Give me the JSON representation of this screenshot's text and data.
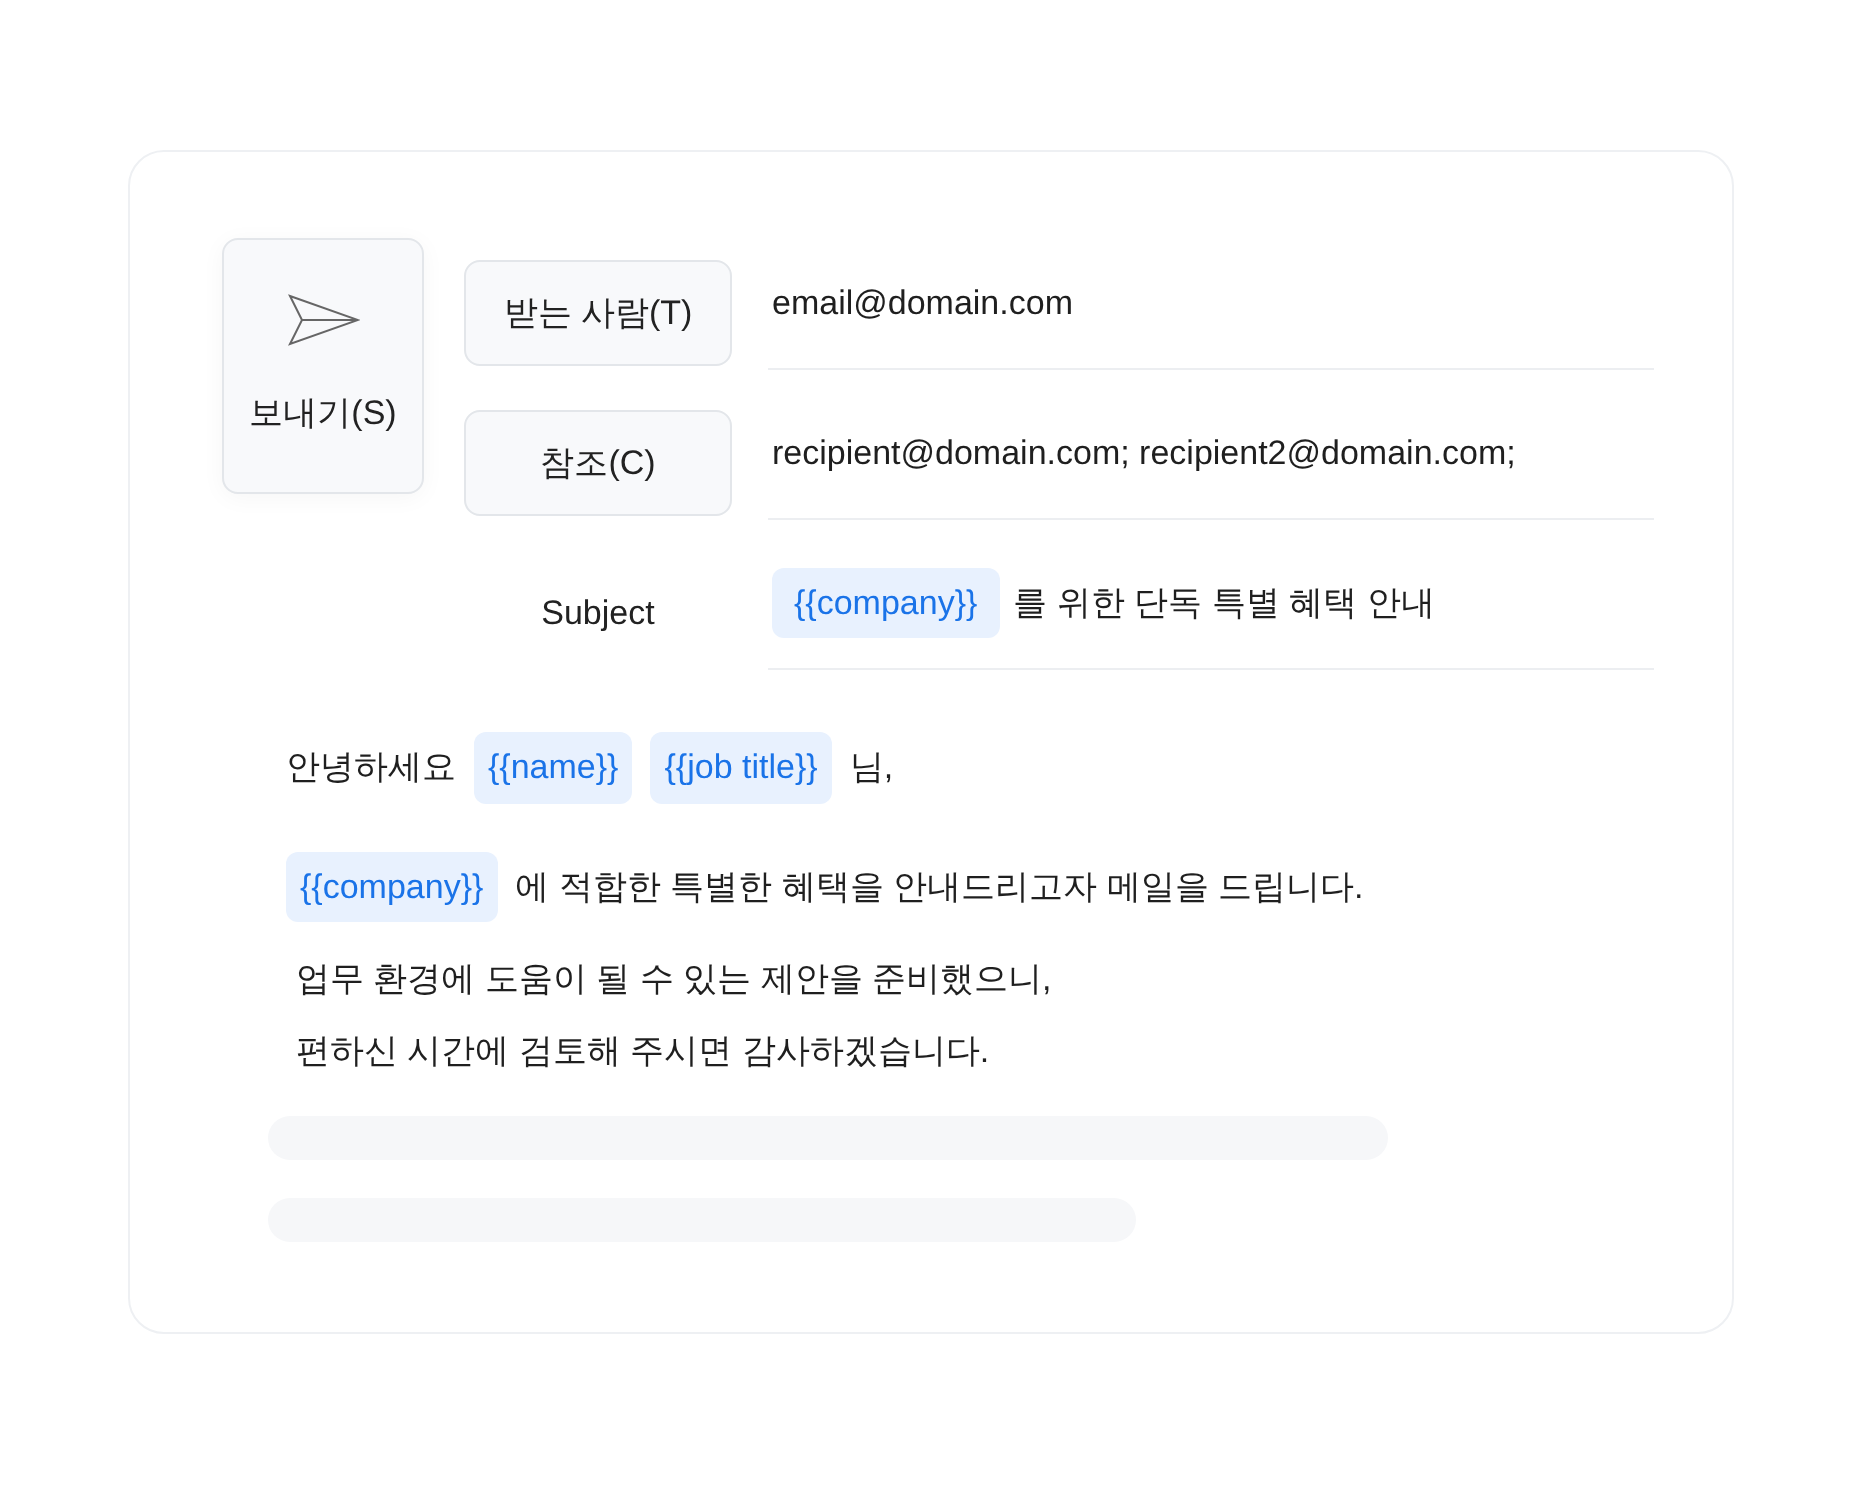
{
  "send_button": {
    "label": "보내기(S)"
  },
  "fields": [
    {
      "kind": "button",
      "label": "받는 사람(T)",
      "value": [
        {
          "kind": "text",
          "text": "email@domain.com"
        }
      ]
    },
    {
      "kind": "button",
      "label": "참조(C)",
      "value": [
        {
          "kind": "text",
          "text": "recipient@domain.com; recipient2@domain.com;"
        }
      ]
    },
    {
      "kind": "label",
      "label": "Subject",
      "value": [
        {
          "kind": "variable",
          "text": "{{company}}"
        },
        {
          "kind": "text",
          "text": "를 위한 단독 특별 혜택 안내"
        }
      ]
    }
  ],
  "body": [
    [
      {
        "kind": "text",
        "text": "안녕하세요"
      },
      {
        "kind": "variable",
        "text": "{{name}}"
      },
      {
        "kind": "variable",
        "text": "{{job title}}"
      },
      {
        "kind": "text",
        "text": "님,"
      }
    ],
    [
      {
        "kind": "variable",
        "text": "{{company}}"
      },
      {
        "kind": "text",
        "text": "에 적합한 특별한 혜택을 안내드리고자 메일을 드립니다."
      }
    ]
  ],
  "paragraph": [
    "업무 환경에 도움이 될 수 있는 제안을 준비했으니,",
    "편하신 시간에 검토해 주시면 감사하겠습니다."
  ]
}
